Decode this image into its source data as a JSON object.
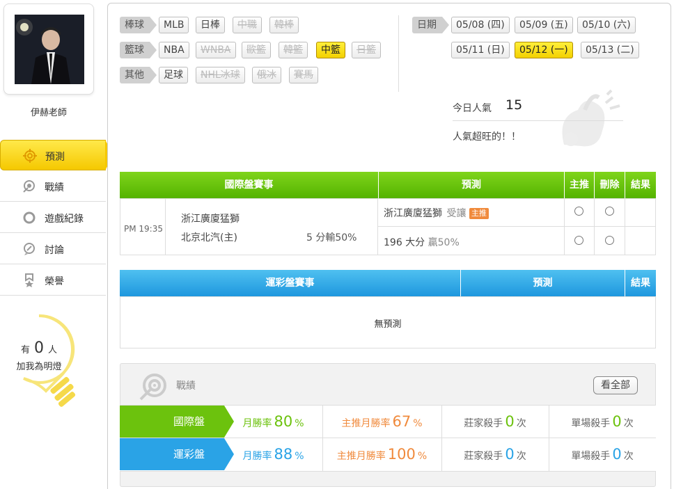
{
  "sidebar": {
    "teacher_name": "伊赫老師",
    "menu": [
      {
        "label": "預測",
        "icon": "target-icon",
        "active": true
      },
      {
        "label": "戰績",
        "icon": "record-icon",
        "active": false
      },
      {
        "label": "遊戲紀錄",
        "icon": "circle-icon",
        "active": false
      },
      {
        "label": "討論",
        "icon": "discussion-icon",
        "active": false
      },
      {
        "label": "榮譽",
        "icon": "medal-icon",
        "active": false
      }
    ],
    "bulb": {
      "prefix": "有",
      "count": "0",
      "suffix": "人",
      "line2": "加我為明燈"
    }
  },
  "filters": {
    "baseball": {
      "head": "棒球",
      "items": [
        "MLB",
        "日棒",
        "中職",
        "韓棒"
      ]
    },
    "basketball": {
      "head": "籃球",
      "items": [
        "NBA",
        "WNBA",
        "歐籃",
        "韓籃",
        "中籃",
        "日籃"
      ]
    },
    "other": {
      "head": "其他",
      "items": [
        "足球",
        "NHL冰球",
        "俄冰",
        "賽馬"
      ]
    }
  },
  "dates": {
    "head": "日期",
    "items": [
      "05/08 (四)",
      "05/09 (五)",
      "05/10 (六)",
      "05/11 (日)",
      "05/12 (一)",
      "05/13 (二)"
    ],
    "selected": "05/12 (一)"
  },
  "popularity": {
    "label": "今日人氣",
    "count": "15",
    "message": "人氣超旺的！！"
  },
  "intl_table": {
    "headers": {
      "event": "國際盤賽事",
      "prediction": "預測",
      "main": "主推",
      "delete": "刪除",
      "result": "結果"
    },
    "row": {
      "time": "PM 19:35",
      "team_away": "浙江廣廈猛獅",
      "team_home": "北京北汽(主)",
      "line": "5 分輸50%",
      "pred1_team": "浙江廣廈猛獅",
      "pred1_type": "受讓",
      "pred1_badge": "主推",
      "pred2_main": "196 大分",
      "pred2_sub": "贏50%"
    }
  },
  "lottery_table": {
    "headers": {
      "event": "運彩盤賽事",
      "prediction": "預測",
      "result": "結果"
    },
    "empty": "無預測"
  },
  "stats": {
    "title": "戰績",
    "view_all": "看全部",
    "rows": [
      {
        "name": "國際盤",
        "month_label": "月勝率",
        "month_val": "80",
        "main_label": "主推月勝率",
        "main_val": "67",
        "banker_label": "莊家殺手",
        "banker_val": "0",
        "single_label": "單場殺手",
        "single_val": "0",
        "pct": "%",
        "times": "次"
      },
      {
        "name": "運彩盤",
        "month_label": "月勝率",
        "month_val": "88",
        "main_label": "主推月勝率",
        "main_val": "100",
        "banker_label": "莊家殺手",
        "banker_val": "0",
        "single_label": "單場殺手",
        "single_val": "0",
        "pct": "%",
        "times": "次"
      }
    ]
  },
  "colors": {
    "green": "#6cc20d",
    "blue": "#2aa3e6",
    "orange": "#f08a3c",
    "yellow": "#f5c800"
  }
}
